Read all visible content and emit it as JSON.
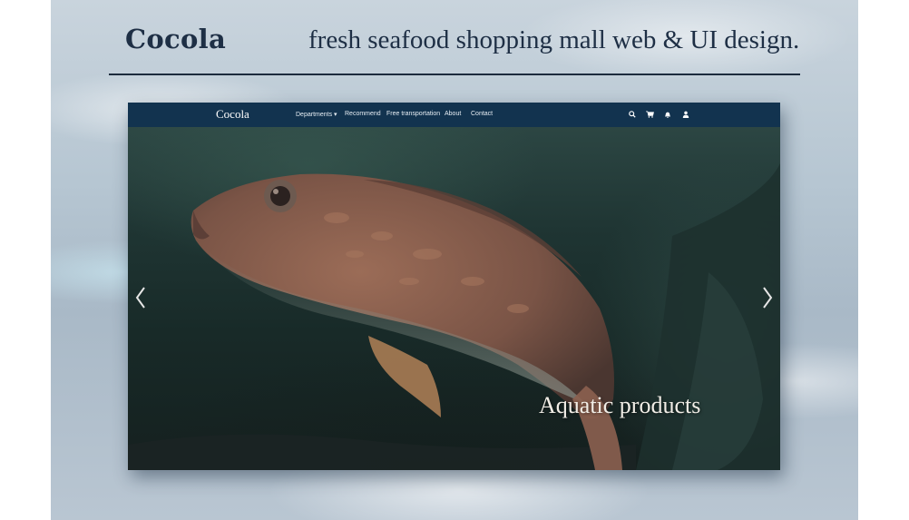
{
  "header": {
    "brand": "Cocola",
    "tagline": "fresh seafood shopping mall web & UI design."
  },
  "site": {
    "logo": "Cocola",
    "nav": [
      {
        "label": "Departments ▾"
      },
      {
        "label": "Recommend"
      },
      {
        "label": "Free transportation"
      },
      {
        "label": "About"
      },
      {
        "label": "Contact"
      }
    ],
    "icons": [
      "search-icon",
      "cart-icon",
      "bell-icon",
      "user-icon"
    ]
  },
  "hero": {
    "caption": "Aquatic products",
    "prev_arrow": "‹",
    "next_arrow": "›"
  },
  "colors": {
    "heading": "#1e2f45",
    "nav_bar": "#12334f",
    "caption": "#f1ede6"
  }
}
